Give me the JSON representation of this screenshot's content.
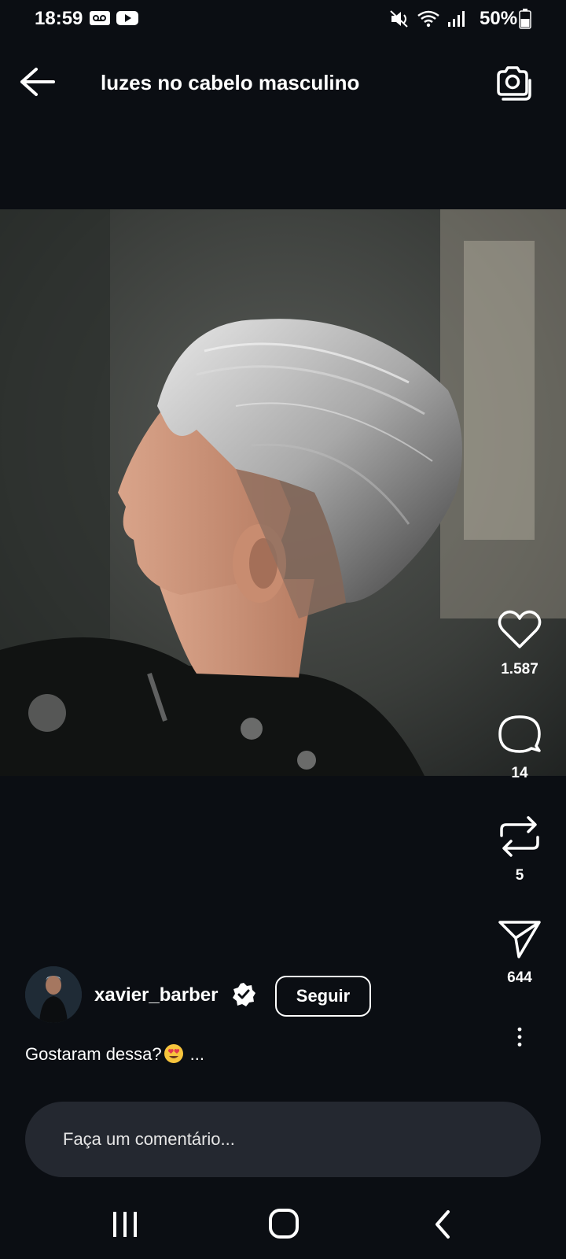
{
  "status_bar": {
    "time": "18:59",
    "battery": "50%",
    "icons": [
      "voicemail-icon",
      "youtube-icon",
      "mute-icon",
      "wifi-icon",
      "signal-icon",
      "battery-icon"
    ]
  },
  "header": {
    "title": "luzes no cabelo masculino",
    "back_icon": "arrow-left-icon",
    "camera_icon": "camera-icon"
  },
  "actions": {
    "likes": "1.587",
    "comments": "14",
    "reposts": "5",
    "shares": "644"
  },
  "post": {
    "username": "xavier_barber",
    "follow_label": "Seguir",
    "caption": "Gostaram dessa?",
    "caption_more": "..."
  },
  "comment": {
    "placeholder": "Faça um comentário..."
  },
  "colors": {
    "background": "#0b0e13",
    "input_bg": "#242830",
    "verified": "#ffffff"
  }
}
